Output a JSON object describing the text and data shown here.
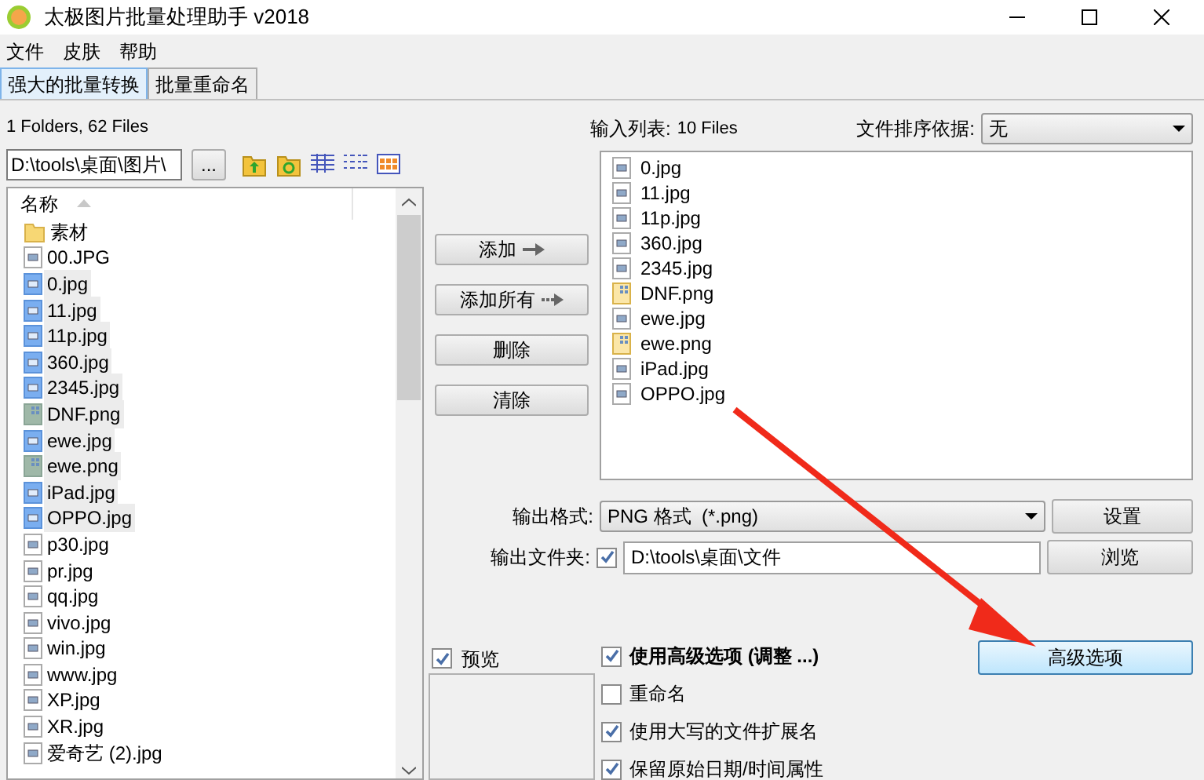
{
  "window": {
    "title": "太极图片批量处理助手  v2018"
  },
  "menu": [
    "文件",
    "皮肤",
    "帮助"
  ],
  "tabs": [
    {
      "label": "强大的批量转换",
      "selected": true
    },
    {
      "label": "批量重命名",
      "selected": false
    }
  ],
  "folder_summary": "1 Folders, 62 Files",
  "path_field": {
    "value": "D:\\tools\\桌面\\图片\\",
    "browse_button": "..."
  },
  "file_list": {
    "column": "名称",
    "items": [
      {
        "name": "素材",
        "kind": "folder",
        "selected": false
      },
      {
        "name": "00.JPG",
        "kind": "jpg",
        "selected": false
      },
      {
        "name": "0.jpg",
        "kind": "jpg",
        "selected": true
      },
      {
        "name": "11.jpg",
        "kind": "jpg",
        "selected": true
      },
      {
        "name": "11p.jpg",
        "kind": "jpg",
        "selected": true
      },
      {
        "name": "360.jpg",
        "kind": "jpg",
        "selected": true
      },
      {
        "name": "2345.jpg",
        "kind": "jpg",
        "selected": true
      },
      {
        "name": "DNF.png",
        "kind": "png",
        "selected": true
      },
      {
        "name": "ewe.jpg",
        "kind": "jpg",
        "selected": true
      },
      {
        "name": "ewe.png",
        "kind": "png",
        "selected": true
      },
      {
        "name": "iPad.jpg",
        "kind": "jpg",
        "selected": true
      },
      {
        "name": "OPPO.jpg",
        "kind": "jpg",
        "selected": true
      },
      {
        "name": "p30.jpg",
        "kind": "jpg",
        "selected": false
      },
      {
        "name": "pr.jpg",
        "kind": "jpg",
        "selected": false
      },
      {
        "name": "qq.jpg",
        "kind": "jpg",
        "selected": false
      },
      {
        "name": "vivo.jpg",
        "kind": "jpg",
        "selected": false
      },
      {
        "name": "win.jpg",
        "kind": "jpg",
        "selected": false
      },
      {
        "name": "www.jpg",
        "kind": "jpg",
        "selected": false
      },
      {
        "name": "XP.jpg",
        "kind": "jpg",
        "selected": false
      },
      {
        "name": "XR.jpg",
        "kind": "jpg",
        "selected": false
      },
      {
        "name": "爱奇艺 (2).jpg",
        "kind": "jpg",
        "selected": false
      }
    ]
  },
  "actions": [
    "添加",
    "添加所有",
    "删除",
    "清除"
  ],
  "input_list": {
    "label": "输入列表:",
    "count": "10 Files",
    "sort_label": "文件排序依据:",
    "sort_value": "无",
    "items": [
      {
        "name": "0.jpg",
        "kind": "jpg"
      },
      {
        "name": "11.jpg",
        "kind": "jpg"
      },
      {
        "name": "11p.jpg",
        "kind": "jpg"
      },
      {
        "name": "360.jpg",
        "kind": "jpg"
      },
      {
        "name": "2345.jpg",
        "kind": "jpg"
      },
      {
        "name": "DNF.png",
        "kind": "png"
      },
      {
        "name": "ewe.jpg",
        "kind": "jpg"
      },
      {
        "name": "ewe.png",
        "kind": "png"
      },
      {
        "name": "iPad.jpg",
        "kind": "jpg"
      },
      {
        "name": "OPPO.jpg",
        "kind": "jpg"
      }
    ]
  },
  "output": {
    "format_label": "输出格式:",
    "format_value": "PNG 格式  (*.png)",
    "settings_button": "设置",
    "folder_label": "输出文件夹:",
    "folder_checked": true,
    "folder_value": "D:\\tools\\桌面\\文件",
    "browse_button": "浏览"
  },
  "preview": {
    "label": "预览",
    "checked": true
  },
  "options": [
    {
      "label": "使用高级选项 (调整 ...)",
      "checked": true,
      "bold": true
    },
    {
      "label": "重命名",
      "checked": false,
      "bold": false
    },
    {
      "label": "使用大写的文件扩展名",
      "checked": true,
      "bold": false
    },
    {
      "label": "保留原始日期/时间属性",
      "checked": true,
      "bold": false
    }
  ],
  "advanced_button": "高级选项"
}
